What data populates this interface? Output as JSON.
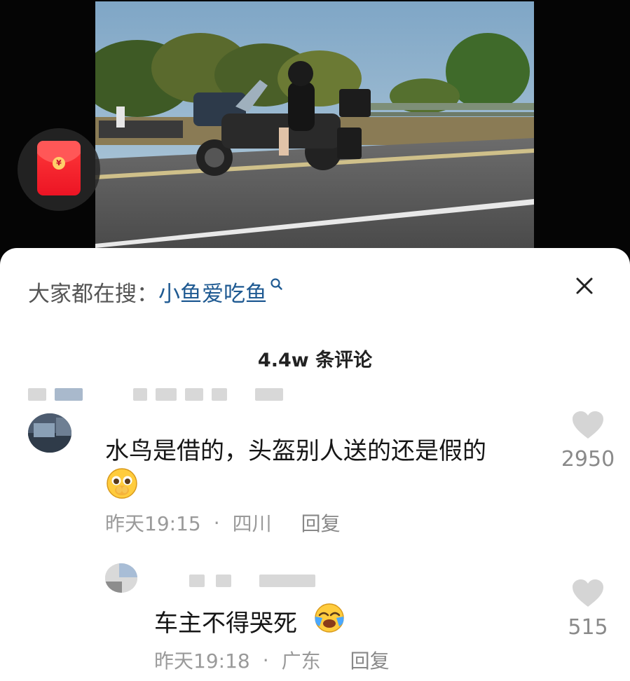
{
  "search_banner": {
    "prefix": "大家都在搜：",
    "term": "小鱼爱吃鱼"
  },
  "comments_header": {
    "count_text": "4.4w 条评论"
  },
  "comments": [
    {
      "text": "水鸟是借的，头盔别人送的还是假的",
      "emoji": "pleading-face-emoji",
      "time": "昨天19:15",
      "separator": "·",
      "location": "四川",
      "reply_label": "回复",
      "likes": "2950"
    },
    {
      "text": "车主不得哭死",
      "emoji": "crying-face-emoji",
      "time": "昨天19:18",
      "separator": "·",
      "location": "广东",
      "reply_label": "回复",
      "likes": "515"
    }
  ],
  "colors": {
    "search_term": "#1f5a92",
    "red_packet": "#ec1424",
    "meta_text": "#9a9a9a"
  },
  "icons": [
    "red-packet-icon",
    "search-icon",
    "close-icon",
    "heart-icon"
  ]
}
